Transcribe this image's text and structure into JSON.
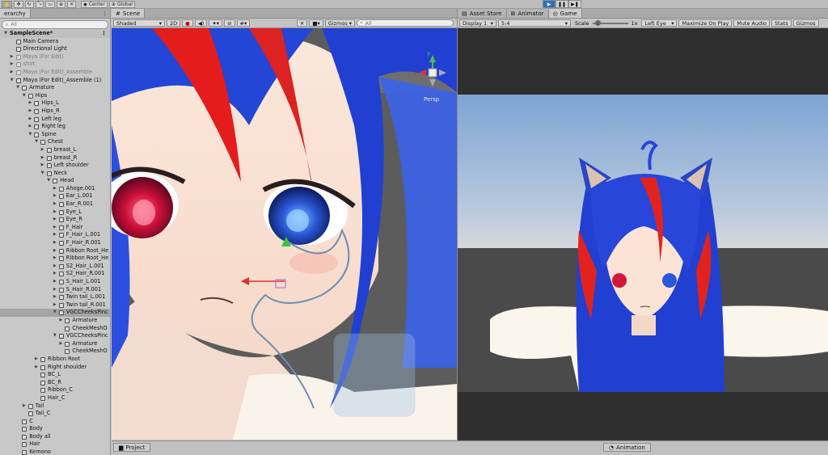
{
  "toolbar": {
    "tools": [
      "hand-tool-icon",
      "move-tool-icon",
      "rotate-tool-icon",
      "scale-tool-icon",
      "rect-tool-icon",
      "transform-tool-icon",
      "custom-tool-icon"
    ],
    "pivot_label": "Center",
    "space_label": "Global"
  },
  "hierarchy": {
    "tab_label": "erarchy",
    "search_placeholder": "All",
    "rows": [
      {
        "label": "SampleScene*",
        "depth": 0,
        "arrow": "▼",
        "scene": true
      },
      {
        "label": "Main Camera",
        "depth": 1,
        "arrow": ""
      },
      {
        "label": "Directional Light",
        "depth": 1,
        "arrow": ""
      },
      {
        "label": "Maya (For Edit)",
        "depth": 1,
        "arrow": "▶",
        "dim": true
      },
      {
        "label": "shirt",
        "depth": 1,
        "arrow": "▶",
        "dim": true
      },
      {
        "label": "Maya (For Edit)_Assemble",
        "depth": 1,
        "arrow": "▶",
        "dim": true
      },
      {
        "label": "Maya (For Edit)_Assemble (1)",
        "depth": 1,
        "arrow": "▼"
      },
      {
        "label": "Armature",
        "depth": 2,
        "arrow": "▼"
      },
      {
        "label": "Hips",
        "depth": 3,
        "arrow": "▼"
      },
      {
        "label": "Hips_L",
        "depth": 4,
        "arrow": "▶"
      },
      {
        "label": "Hips_R",
        "depth": 4,
        "arrow": "▶"
      },
      {
        "label": "Left leg",
        "depth": 4,
        "arrow": "▶"
      },
      {
        "label": "Right leg",
        "depth": 4,
        "arrow": "▶"
      },
      {
        "label": "Spine",
        "depth": 4,
        "arrow": "▼"
      },
      {
        "label": "Chest",
        "depth": 5,
        "arrow": "▼"
      },
      {
        "label": "breast_L",
        "depth": 6,
        "arrow": "▶"
      },
      {
        "label": "breast_R",
        "depth": 6,
        "arrow": "▶"
      },
      {
        "label": "Left shoulder",
        "depth": 6,
        "arrow": "▶"
      },
      {
        "label": "Neck",
        "depth": 6,
        "arrow": "▼"
      },
      {
        "label": "Head",
        "depth": 7,
        "arrow": "▼"
      },
      {
        "label": "Ahoge.001",
        "depth": 8,
        "arrow": "▶"
      },
      {
        "label": "Ear_L.001",
        "depth": 8,
        "arrow": "▶"
      },
      {
        "label": "Ear_R.001",
        "depth": 8,
        "arrow": "▶"
      },
      {
        "label": "Eye_L",
        "depth": 8,
        "arrow": "▶"
      },
      {
        "label": "Eye_R",
        "depth": 8,
        "arrow": "▶"
      },
      {
        "label": "F_Hair",
        "depth": 8,
        "arrow": "▶"
      },
      {
        "label": "F_Hair_L.001",
        "depth": 8,
        "arrow": "▶"
      },
      {
        "label": "F_Hair_R.001",
        "depth": 8,
        "arrow": "▶"
      },
      {
        "label": "Ribbon Root_He",
        "depth": 8,
        "arrow": "▶"
      },
      {
        "label": "Ribbon Root_He",
        "depth": 8,
        "arrow": "▶"
      },
      {
        "label": "S2_Hair_L.001",
        "depth": 8,
        "arrow": "▶"
      },
      {
        "label": "S2_Hair_R.001",
        "depth": 8,
        "arrow": "▶"
      },
      {
        "label": "S_Hair_L.001",
        "depth": 8,
        "arrow": "▶"
      },
      {
        "label": "S_Hair_R.001",
        "depth": 8,
        "arrow": "▶"
      },
      {
        "label": "Twin tail_L.001",
        "depth": 8,
        "arrow": "▶"
      },
      {
        "label": "Twin tail_R.001",
        "depth": 8,
        "arrow": "▶"
      },
      {
        "label": "VGCCheeksPinc",
        "depth": 8,
        "arrow": "▼",
        "sel": true
      },
      {
        "label": "Armature",
        "depth": 9,
        "arrow": "▶"
      },
      {
        "label": "CheekMeshO",
        "depth": 9,
        "arrow": ""
      },
      {
        "label": "VGCCheeksPinc",
        "depth": 8,
        "arrow": "▼"
      },
      {
        "label": "Armature",
        "depth": 9,
        "arrow": "▶"
      },
      {
        "label": "CheekMeshO",
        "depth": 9,
        "arrow": ""
      },
      {
        "label": "Ribbon Root",
        "depth": 5,
        "arrow": "▶"
      },
      {
        "label": "Right shoulder",
        "depth": 5,
        "arrow": "▶"
      },
      {
        "label": "BC_L",
        "depth": 5,
        "arrow": ""
      },
      {
        "label": "BC_R",
        "depth": 5,
        "arrow": ""
      },
      {
        "label": "Ribbon_C",
        "depth": 5,
        "arrow": ""
      },
      {
        "label": "Hair_C",
        "depth": 5,
        "arrow": ""
      },
      {
        "label": "Tail",
        "depth": 3,
        "arrow": "▶"
      },
      {
        "label": "Tail_C",
        "depth": 3,
        "arrow": ""
      },
      {
        "label": "C",
        "depth": 2,
        "arrow": ""
      },
      {
        "label": "Body",
        "depth": 2,
        "arrow": ""
      },
      {
        "label": "Body all",
        "depth": 2,
        "arrow": ""
      },
      {
        "label": "Hair",
        "depth": 2,
        "arrow": ""
      },
      {
        "label": "Kemono",
        "depth": 2,
        "arrow": ""
      }
    ]
  },
  "scene": {
    "tab_label": "Scene",
    "shading_mode": "Shaded",
    "mode_2d": "2D",
    "gizmos_label": "Gizmos",
    "search_placeholder": "All",
    "persp_label": "Persp",
    "axis_y": "y",
    "axis_x": "x"
  },
  "game": {
    "tabs": [
      "Asset Store",
      "Animator",
      "Game"
    ],
    "display": "Display 1",
    "aspect": "5:4",
    "scale_label": "Scale",
    "scale_value": "1x",
    "eye": "Left Eye",
    "maximize": "Maximize On Play",
    "mute": "Mute Audio",
    "stats": "Stats",
    "gizmos": "Gizmos",
    "scale_level": 0.1
  },
  "bottom": {
    "project_tab": "Project",
    "animation_tab": "Animation"
  },
  "colors": {
    "hair_blue": "#1f3fd0",
    "hair_red": "#e21a1a",
    "skin": "#fbe4d6",
    "sky": "#8aaed8",
    "play_active": "#2e6fb8"
  }
}
